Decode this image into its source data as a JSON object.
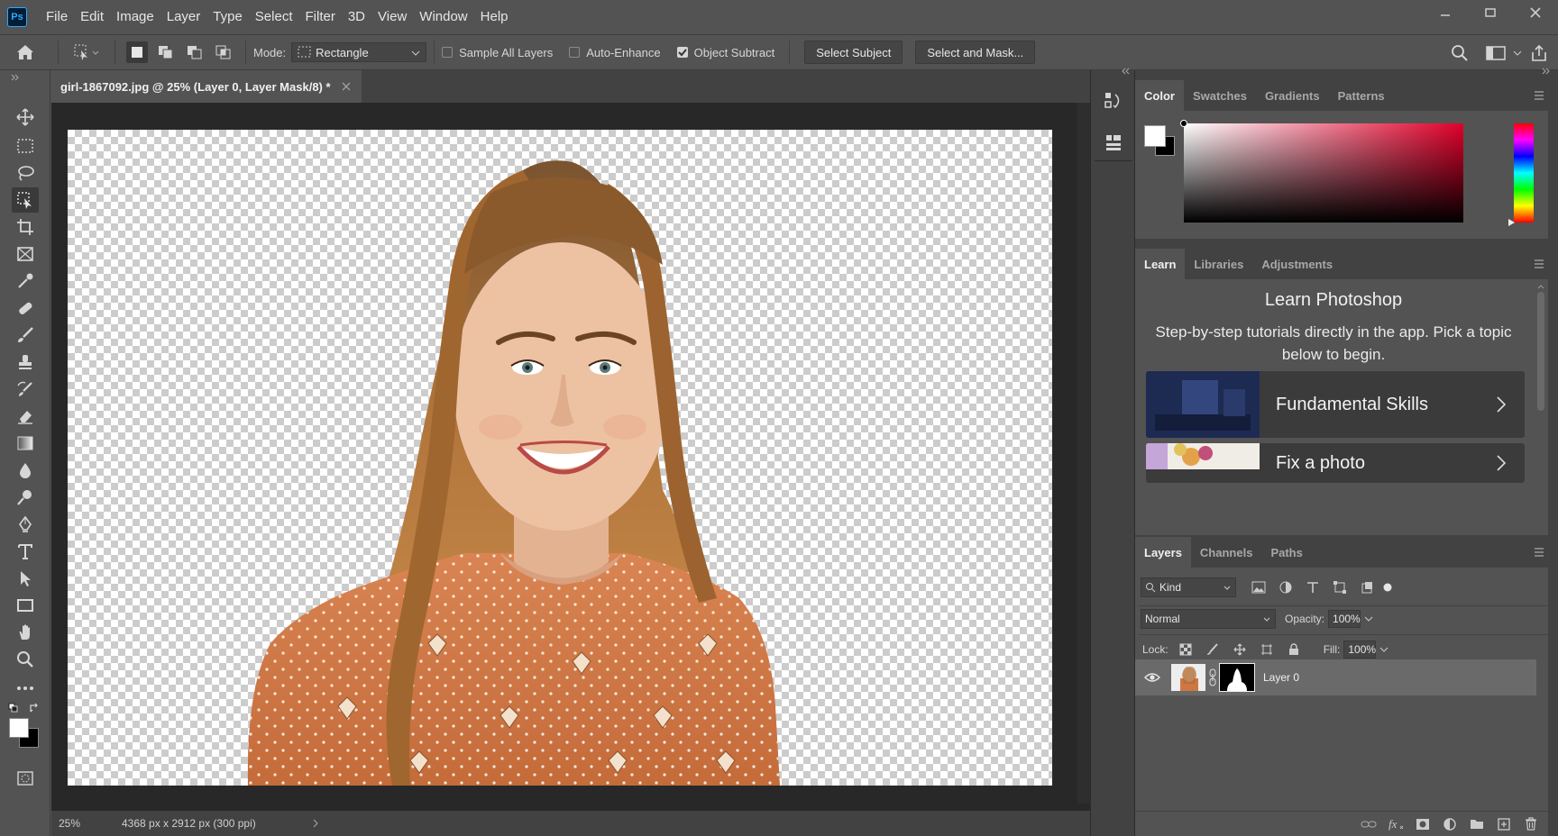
{
  "app": {
    "logo": "Ps"
  },
  "menus": [
    "File",
    "Edit",
    "Image",
    "Layer",
    "Type",
    "Select",
    "Filter",
    "3D",
    "View",
    "Window",
    "Help"
  ],
  "options": {
    "mode_label": "Mode:",
    "mode_value": "Rectangle",
    "sample_all_layers": "Sample All Layers",
    "auto_enhance": "Auto-Enhance",
    "object_subtract": "Object Subtract",
    "select_subject": "Select Subject",
    "select_and_mask": "Select and Mask..."
  },
  "document": {
    "tab_title": "girl-1867092.jpg @ 25% (Layer 0, Layer Mask/8) *",
    "zoom": "25%",
    "info": "4368 px x 2912 px (300 ppi)"
  },
  "color_panel": {
    "tabs": [
      "Color",
      "Swatches",
      "Gradients",
      "Patterns"
    ],
    "hue_color": "#e0002a"
  },
  "learn_panel": {
    "tabs": [
      "Learn",
      "Libraries",
      "Adjustments"
    ],
    "title": "Learn Photoshop",
    "description": "Step-by-step tutorials directly in the app. Pick a topic below to begin.",
    "cards": [
      {
        "title": "Fundamental Skills"
      },
      {
        "title": "Fix a photo"
      }
    ]
  },
  "layers_panel": {
    "tabs": [
      "Layers",
      "Channels",
      "Paths"
    ],
    "filter_kind": "Kind",
    "blend_mode": "Normal",
    "opacity_label": "Opacity:",
    "opacity": "100%",
    "lock_label": "Lock:",
    "fill_label": "Fill:",
    "fill": "100%",
    "layers": [
      {
        "name": "Layer 0"
      }
    ]
  }
}
